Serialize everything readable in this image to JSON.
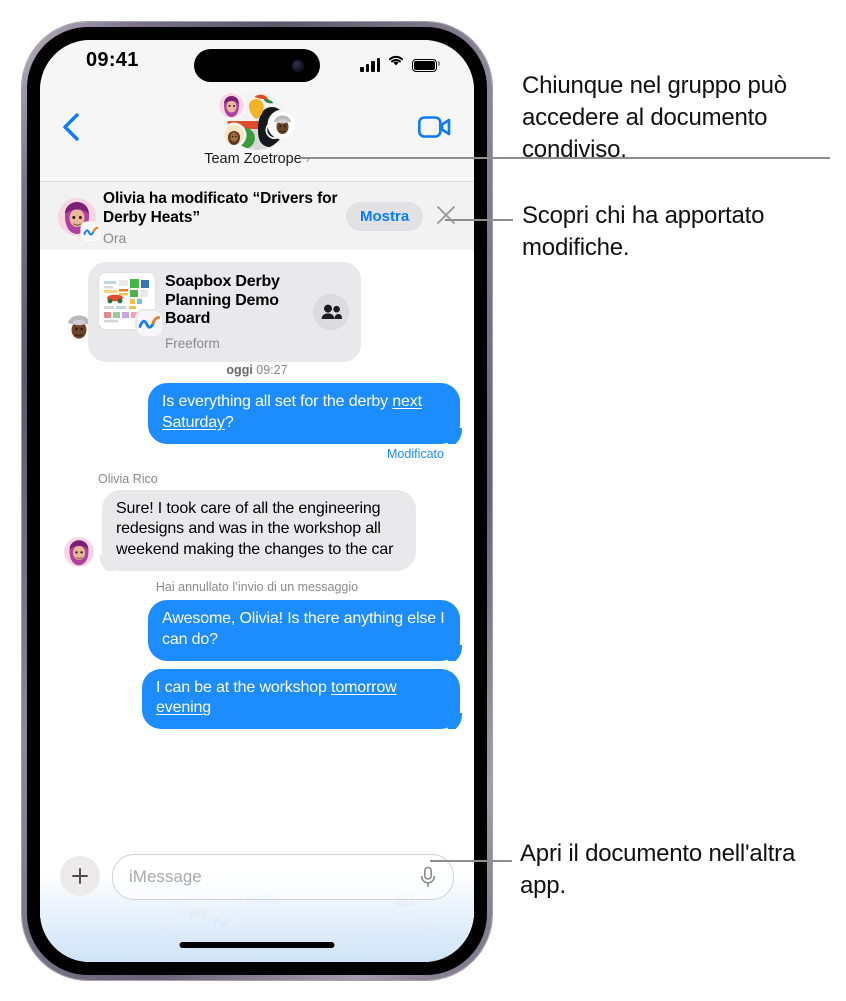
{
  "status_bar": {
    "time": "09:41",
    "signal_icon": "cellular-signal-icon",
    "wifi_icon": "wifi-icon",
    "battery_icon": "battery-icon"
  },
  "nav_bar": {
    "back_icon": "back-chevron-icon",
    "video_icon": "facetime-video-icon",
    "group_name": "Team Zoetrope",
    "group_chevron": "›"
  },
  "notification": {
    "title": "Olivia ha modificato “Drivers for Derby Heats”",
    "subtitle": "Ora",
    "show_label": "Mostra",
    "close_icon": "close-icon",
    "avatar": "olivia-memoji-avatar",
    "app_badge": "freeform-app-icon"
  },
  "conversation": {
    "freeform_card": {
      "title": "Soapbox Derby Planning Demo Board",
      "subtitle": "Freeform",
      "people_icon": "shared-with-people-icon",
      "thumb": "freeform-board-thumbnail",
      "app_icon": "freeform-app-icon"
    },
    "timestamp": {
      "day": "oggi",
      "time": "09:27",
      "full": "oggi 09:27"
    },
    "messages": [
      {
        "id": "msg-1",
        "direction": "out",
        "text_before": "Is everything all set for the derby ",
        "text_link": "next Saturday",
        "text_after": "?",
        "edited_label": "Modificato"
      },
      {
        "id": "msg-2",
        "direction": "in",
        "sender": "Olivia Rico",
        "text": "Sure! I took care of all the engineering redesigns and was in the workshop all weekend making the changes to the car"
      },
      {
        "id": "msg-3",
        "direction": "out",
        "text": "Awesome, Olivia! Is there anything else I can do?"
      },
      {
        "id": "msg-4",
        "direction": "out",
        "text_before": "I can be at the workshop ",
        "text_link": "tomorrow evening"
      }
    ],
    "unsend_note": "Hai annullato l’invio di un messaggio",
    "doc_card": {
      "title": "Drivers for Derby Heats",
      "people_icon": "shared-with-people-icon",
      "thumb": "derby-heats-document-thumbnail",
      "app_icon": "numbers-app-icon"
    }
  },
  "input_bar": {
    "plus_icon": "add-attachment-icon",
    "placeholder": "iMessage",
    "mic_icon": "microphone-icon"
  },
  "callouts": [
    {
      "id": "callout-shared-doc",
      "text": "Chiunque nel gruppo può accedere al documento condiviso."
    },
    {
      "id": "callout-who-edited",
      "text": "Scopri chi ha apportato modifiche."
    },
    {
      "id": "callout-open-doc",
      "text": "Apri il documento nell'altra app."
    }
  ],
  "colors": {
    "imessage_blue": "#1d8cff",
    "accent_blue": "#0a7cff",
    "bubble_gray": "#e9e9eb",
    "chrome_gray": "#f6f6f6"
  }
}
